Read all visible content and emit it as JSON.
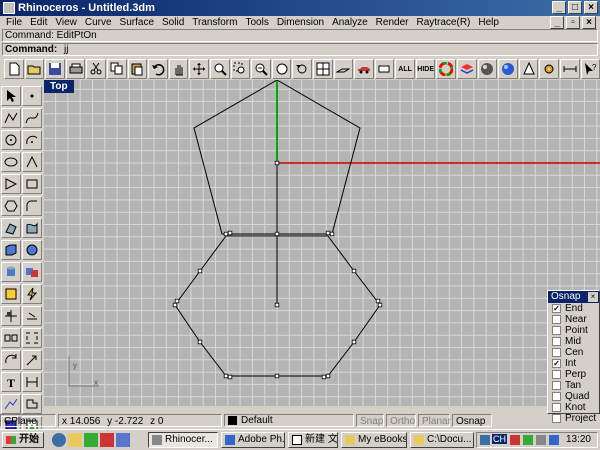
{
  "window": {
    "title": "Rhinoceros - Untitled.3dm"
  },
  "menu": [
    "File",
    "Edit",
    "View",
    "Curve",
    "Surface",
    "Solid",
    "Transform",
    "Tools",
    "Dimension",
    "Analyze",
    "Render",
    "Raytrace(R)",
    "Help"
  ],
  "command": {
    "history": "Command: EditPtOn",
    "prompt": "Command:",
    "value": "jj"
  },
  "toolbar": {
    "all_label": "ALL",
    "hide_label": "HIDE"
  },
  "viewport": {
    "label": "Top",
    "axis_y": "y",
    "axis_x": "x"
  },
  "status": {
    "cplane": "CPlane",
    "x": "x 14.056",
    "y": "y -2.722",
    "z": "z 0",
    "layer": "Default",
    "snap": "Snap",
    "ortho": "Ortho",
    "planar": "Planar",
    "osnap": "Osnap"
  },
  "osnap_panel": {
    "title": "Osnap",
    "items": [
      {
        "label": "End",
        "checked": true
      },
      {
        "label": "Near",
        "checked": false
      },
      {
        "label": "Point",
        "checked": false
      },
      {
        "label": "Mid",
        "checked": false
      },
      {
        "label": "Cen",
        "checked": false
      },
      {
        "label": "Int",
        "checked": true
      },
      {
        "label": "Perp",
        "checked": false
      },
      {
        "label": "Tan",
        "checked": false
      },
      {
        "label": "Quad",
        "checked": false
      },
      {
        "label": "Knot",
        "checked": false
      },
      {
        "label": "Project",
        "checked": false
      }
    ]
  },
  "taskbar": {
    "start": "开始",
    "tasks": [
      "Rhinocer...",
      "Adobe Ph...",
      "新建 文...",
      "My eBooks",
      "C:\\Docu..."
    ],
    "tray_lang": "CH",
    "clock": "13:20"
  },
  "colors": {
    "titlebar": "#0a246a",
    "grid_bg": "#b4b4b4",
    "grid_line": "#d8d8d8",
    "x_axis": "#cc0000",
    "y_axis": "#00aa00"
  }
}
